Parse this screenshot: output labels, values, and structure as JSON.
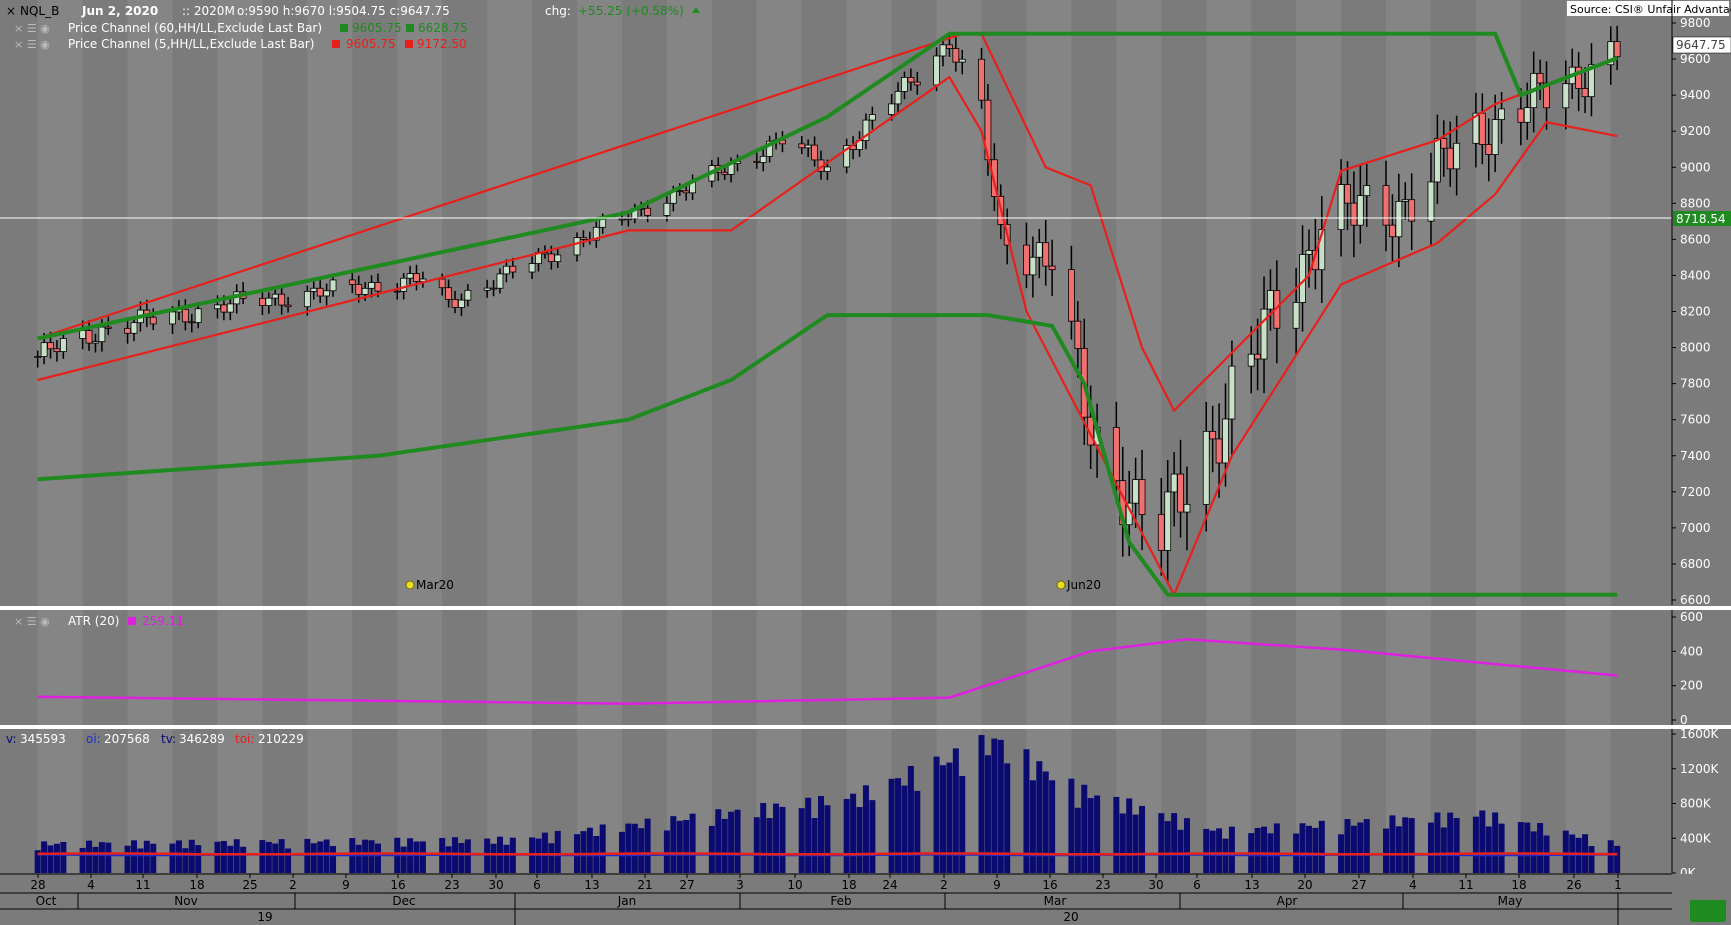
{
  "header": {
    "symbol": "NQL_B",
    "date": "Jun  2, 2020",
    "contract": ":: 2020M",
    "ohlc": "o:9590 h:9670 l:9504.75 c:9647.75",
    "chg_label": "chg:",
    "chg_value": "+55.25 (+0.58%)",
    "source": "Source: CSI® Unfair Advantage®"
  },
  "indicators": {
    "pc60": {
      "label": "Price Channel (60,HH/LL,Exclude Last Bar)",
      "v1": "9605.75",
      "v2": "6628.75",
      "color": "#1f8a1f"
    },
    "pc5": {
      "label": "Price Channel (5,HH/LL,Exclude Last Bar)",
      "v1": "9605.75",
      "v2": "9172.50",
      "color": "#e8201c"
    },
    "atr": {
      "label": "ATR (20)",
      "value": "259.11",
      "color": "#e020e0"
    },
    "volume": {
      "v_label": "v:",
      "v": "345593",
      "oi_label": "oi:",
      "oi": "207568",
      "tv_label": "tv:",
      "tv": "346289",
      "toi_label": "toi:",
      "toi": "210229"
    }
  },
  "markers": {
    "expiry1": "Mar20",
    "expiry2": "Jun20"
  },
  "price_badges": {
    "last": "9647.75",
    "crosshair": "8718.54"
  },
  "axes": {
    "price_ticks": [
      "9800",
      "9600",
      "9400",
      "9200",
      "9000",
      "8800",
      "8600",
      "8400",
      "8200",
      "8000",
      "7800",
      "7600",
      "7400",
      "7200",
      "7000",
      "6800",
      "6600"
    ],
    "atr_ticks": [
      "600",
      "400",
      "200",
      "0"
    ],
    "volume_ticks": [
      "1600K",
      "1200K",
      "800K",
      "400K",
      "0K"
    ],
    "day_ticks": [
      "28",
      "4",
      "11",
      "18",
      "25",
      "2",
      "9",
      "16",
      "23",
      "30",
      "6",
      "13",
      "21",
      "27",
      "3",
      "10",
      "18",
      "24",
      "2",
      "9",
      "16",
      "23",
      "30",
      "6",
      "13",
      "20",
      "27",
      "4",
      "11",
      "18",
      "26",
      "1"
    ],
    "months": [
      "Oct",
      "Nov",
      "Dec",
      "Jan",
      "Feb",
      "Mar",
      "Apr",
      "May"
    ],
    "years": [
      "19",
      "20"
    ]
  },
  "colors": {
    "up_candle": "#c8e0c8",
    "down_candle": "#f07070",
    "volume_bar": "#0a0a70",
    "oi_line": "#e8201c",
    "tv_line": "#1a2fd0"
  },
  "chart_data": {
    "type": "candlestick",
    "x_range": [
      "2019-10-01",
      "2020-06-02"
    ],
    "price_ylim": [
      6600,
      9800
    ],
    "price_close_keypoints": [
      {
        "date": "2019-09-30",
        "value": 7950
      },
      {
        "date": "2019-10-10",
        "value": 8100
      },
      {
        "date": "2019-11-01",
        "value": 8250
      },
      {
        "date": "2019-11-29",
        "value": 8380
      },
      {
        "date": "2019-12-03",
        "value": 8250
      },
      {
        "date": "2019-12-31",
        "value": 8730
      },
      {
        "date": "2020-01-10",
        "value": 8900
      },
      {
        "date": "2020-01-24",
        "value": 9150
      },
      {
        "date": "2020-01-31",
        "value": 9000
      },
      {
        "date": "2020-02-19",
        "value": 9700
      },
      {
        "date": "2020-02-24",
        "value": 9300
      },
      {
        "date": "2020-02-27",
        "value": 8600
      },
      {
        "date": "2020-03-06",
        "value": 8500
      },
      {
        "date": "2020-03-12",
        "value": 7500
      },
      {
        "date": "2020-03-20",
        "value": 7100
      },
      {
        "date": "2020-03-23",
        "value": 6950
      },
      {
        "date": "2020-04-01",
        "value": 7600
      },
      {
        "date": "2020-04-13",
        "value": 8400
      },
      {
        "date": "2020-04-17",
        "value": 8700
      },
      {
        "date": "2020-04-30",
        "value": 8800
      },
      {
        "date": "2020-05-11",
        "value": 9200
      },
      {
        "date": "2020-05-22",
        "value": 9400
      },
      {
        "date": "2020-06-02",
        "value": 9647.75
      }
    ],
    "price_channel_60": {
      "upper": [
        {
          "date": "2019-09-30",
          "value": 8050
        },
        {
          "date": "2019-12-31",
          "value": 8750
        },
        {
          "date": "2020-01-31",
          "value": 9280
        },
        {
          "date": "2020-02-19",
          "value": 9740
        },
        {
          "date": "2020-05-14",
          "value": 9740
        },
        {
          "date": "2020-05-18",
          "value": 9400
        },
        {
          "date": "2020-06-02",
          "value": 9605.75
        }
      ],
      "lower": [
        {
          "date": "2019-09-30",
          "value": 7270
        },
        {
          "date": "2019-11-22",
          "value": 7400
        },
        {
          "date": "2019-12-31",
          "value": 7600
        },
        {
          "date": "2020-01-16",
          "value": 7820
        },
        {
          "date": "2020-01-31",
          "value": 8180
        },
        {
          "date": "2020-02-25",
          "value": 8180
        },
        {
          "date": "2020-03-06",
          "value": 8120
        },
        {
          "date": "2020-03-11",
          "value": 7800
        },
        {
          "date": "2020-03-18",
          "value": 6920
        },
        {
          "date": "2020-03-24",
          "value": 6628.75
        },
        {
          "date": "2020-06-02",
          "value": 6628.75
        }
      ]
    },
    "price_channel_5": {
      "upper": [
        {
          "date": "2019-09-30",
          "value": 8050
        },
        {
          "date": "2020-02-21",
          "value": 9740
        },
        {
          "date": "2020-02-24",
          "value": 9740
        },
        {
          "date": "2020-03-05",
          "value": 9000
        },
        {
          "date": "2020-03-12",
          "value": 8900
        },
        {
          "date": "2020-03-20",
          "value": 8000
        },
        {
          "date": "2020-03-25",
          "value": 7650
        },
        {
          "date": "2020-04-01",
          "value": 7900
        },
        {
          "date": "2020-04-15",
          "value": 8400
        },
        {
          "date": "2020-04-20",
          "value": 8980
        },
        {
          "date": "2020-05-05",
          "value": 9150
        },
        {
          "date": "2020-05-14",
          "value": 9350
        },
        {
          "date": "2020-06-02",
          "value": 9605.75
        }
      ],
      "lower": [
        {
          "date": "2019-09-30",
          "value": 7820
        },
        {
          "date": "2019-12-31",
          "value": 8650
        },
        {
          "date": "2020-01-16",
          "value": 8650
        },
        {
          "date": "2020-02-19",
          "value": 9500
        },
        {
          "date": "2020-02-24",
          "value": 9200
        },
        {
          "date": "2020-03-02",
          "value": 8200
        },
        {
          "date": "2020-03-25",
          "value": 6628.75
        },
        {
          "date": "2020-04-03",
          "value": 7400
        },
        {
          "date": "2020-04-20",
          "value": 8350
        },
        {
          "date": "2020-05-05",
          "value": 8580
        },
        {
          "date": "2020-05-14",
          "value": 8850
        },
        {
          "date": "2020-05-22",
          "value": 9250
        },
        {
          "date": "2020-06-02",
          "value": 9172.5
        }
      ]
    },
    "atr_20": {
      "ylim": [
        0,
        600
      ],
      "points": [
        {
          "date": "2019-09-30",
          "value": 135
        },
        {
          "date": "2019-12-31",
          "value": 95
        },
        {
          "date": "2020-02-19",
          "value": 130
        },
        {
          "date": "2020-03-12",
          "value": 400
        },
        {
          "date": "2020-03-27",
          "value": 470
        },
        {
          "date": "2020-04-20",
          "value": 410
        },
        {
          "date": "2020-06-02",
          "value": 259.11
        }
      ]
    },
    "volume": {
      "ylim": [
        0,
        1600000
      ],
      "bars_keypoints": [
        {
          "date": "2019-10-01",
          "value": 350000
        },
        {
          "date": "2019-12-13",
          "value": 400000
        },
        {
          "date": "2020-02-04",
          "value": 900000
        },
        {
          "date": "2020-02-26",
          "value": 1580000
        },
        {
          "date": "2020-03-10",
          "value": 1000000
        },
        {
          "date": "2020-04-01",
          "value": 500000
        },
        {
          "date": "2020-05-12",
          "value": 700000
        },
        {
          "date": "2020-06-02",
          "value": 345593
        }
      ],
      "open_interest_line": {
        "value_first": 220000,
        "value_last": 207568
      },
      "total_volume_last": 346289,
      "total_open_interest_last": 210229
    }
  }
}
